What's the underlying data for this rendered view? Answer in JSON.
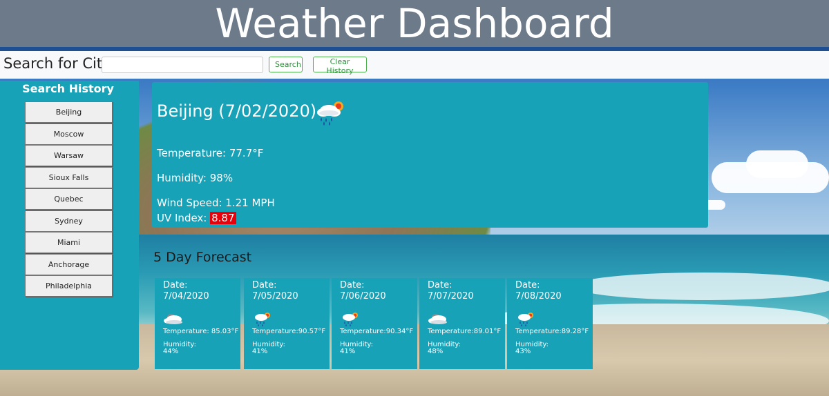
{
  "header": {
    "title": "Weather Dashboard"
  },
  "search": {
    "label": "Search for City",
    "input_value": "",
    "search_label": "Search",
    "clear_label": "Clear History"
  },
  "sidebar": {
    "title": "Search History",
    "items": [
      "Beijing",
      "Moscow",
      "Warsaw",
      "Sioux Falls",
      "Quebec",
      "Sydney",
      "Miami",
      "Anchorage",
      "Philadelphia"
    ]
  },
  "current": {
    "title": "Beijing (7/02/2020)",
    "icon": "rain-sun-icon",
    "temperature": "Temperature: 77.7°F",
    "humidity": "Humidity: 98%",
    "wind": "Wind Speed: 1.21 MPH",
    "uv_label": "UV Index: ",
    "uv_value": "8.87",
    "uv_color": "#e8000b"
  },
  "forecast": {
    "title": "5 Day Forecast",
    "days": [
      {
        "date_label": "Date:",
        "date": "7/04/2020",
        "icon": "cloud-icon",
        "temp": "Temperature: 85.03°F",
        "hum_label": "Humidity:",
        "hum": "44%"
      },
      {
        "date_label": "Date:",
        "date": "7/05/2020",
        "icon": "rain-sun-icon",
        "temp": "Temperature:90.57°F",
        "hum_label": "Humidity:",
        "hum": "41%"
      },
      {
        "date_label": "Date:",
        "date": "7/06/2020",
        "icon": "rain-sun-icon",
        "temp": "Temperature:90.34°F",
        "hum_label": "Humidity:",
        "hum": "41%"
      },
      {
        "date_label": "Date:",
        "date": "7/07/2020",
        "icon": "cloud-icon",
        "temp": "Temperature:89.01°F",
        "hum_label": "Humidity:",
        "hum": "48%"
      },
      {
        "date_label": "Date:",
        "date": "7/08/2020",
        "icon": "rain-sun-icon",
        "temp": "Temperature:89.28°F",
        "hum_label": "Humidity:",
        "hum": "43%"
      }
    ]
  },
  "colors": {
    "panel": "#17a2b8",
    "header": "#6c7a8a",
    "button_border": "#4cae4c"
  }
}
